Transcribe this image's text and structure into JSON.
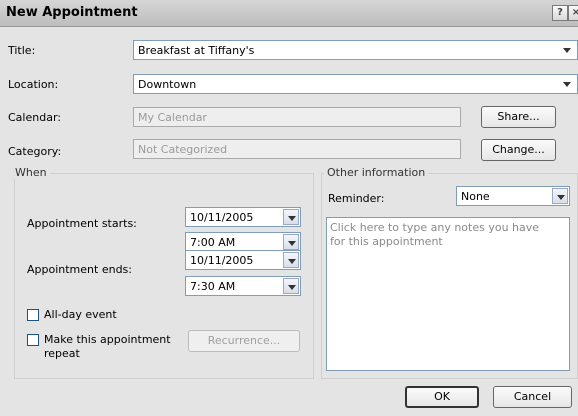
{
  "window": {
    "title": "New Appointment",
    "help_glyph": "?",
    "close_glyph": "×"
  },
  "fields": {
    "title": {
      "label": "Title:",
      "value": "Breakfast at Tiffany's"
    },
    "location": {
      "label": "Location:",
      "value": "Downtown"
    },
    "calendar": {
      "label": "Calendar:",
      "value": "My Calendar",
      "button": "Share..."
    },
    "category": {
      "label": "Category:",
      "value": "Not Categorized",
      "button": "Change..."
    }
  },
  "when": {
    "group_label": "When",
    "starts_label": "Appointment starts:",
    "start_date": "10/11/2005",
    "start_time": "7:00 AM",
    "ends_label": "Appointment ends:",
    "end_date": "10/11/2005",
    "end_time": "7:30 AM",
    "all_day_label": "All-day event",
    "repeat_label": "Make this appointment repeat",
    "recurrence_button": "Recurrence..."
  },
  "other": {
    "group_label": "Other information",
    "reminder_label": "Reminder:",
    "reminder_value": "None",
    "notes_placeholder": "Click here to type any notes you have for this appointment"
  },
  "buttons": {
    "ok": "OK",
    "cancel": "Cancel"
  }
}
